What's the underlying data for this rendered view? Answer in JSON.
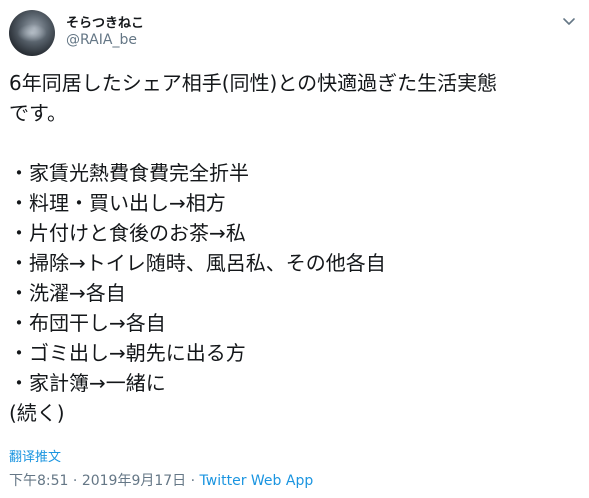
{
  "author": {
    "display_name": "そらつきねこ",
    "handle": "@RAIA_be"
  },
  "tweet": {
    "lines": [
      "6年同居したシェア相手(同性)との快適過ぎた生活実態",
      "です。",
      "",
      "・家賃光熱費食費完全折半",
      "・料理・買い出し→相方",
      "・片付けと食後のお茶→私",
      "・掃除→トイレ随時、風呂私、その他各自",
      "・洗濯→各自",
      "・布団干し→各自",
      "・ゴミ出し→朝先に出る方",
      "・家計簿→一緒に",
      "(続く)"
    ]
  },
  "translate_label": "翻译推文",
  "meta": {
    "time": "下午8:51",
    "sep1": " · ",
    "date": "2019年9月17日",
    "sep2": " · ",
    "source": "Twitter Web App"
  },
  "icons": {
    "more": "chevron-down-icon"
  },
  "colors": {
    "link": "#1b95e0",
    "secondary_text": "#657786",
    "primary_text": "#14171a"
  }
}
